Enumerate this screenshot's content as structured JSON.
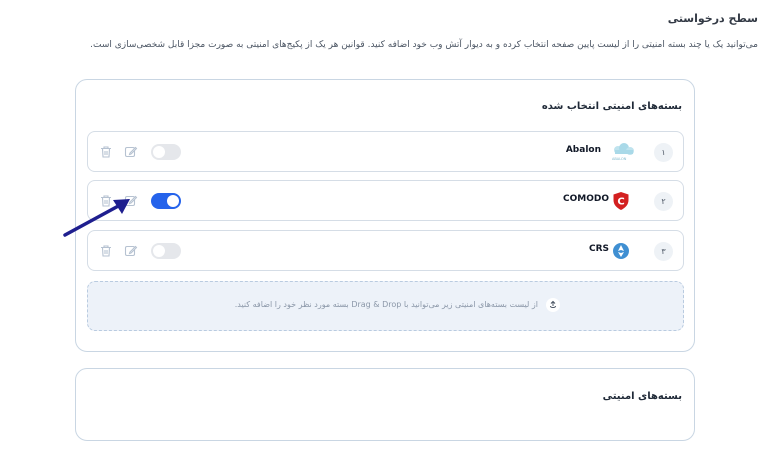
{
  "page": {
    "title": "سطح درخواستی",
    "description": "می‌توانید یک یا چند بسته امنیتی را از لیست پایین صفحه انتخاب کرده و به دیوار آتش وب خود اضافه کنید. قوانین هر یک از پکیج‌های امنیتی به صورت مجزا قابل شخصی‌سازی است."
  },
  "selected_panel": {
    "title": "بسته‌های امنیتی انتخاب شده",
    "rows": [
      {
        "index": "۱",
        "name": "Abalon",
        "logo_caption": "ABALON",
        "enabled": false,
        "logo": "abalon-cloud-logo"
      },
      {
        "index": "۲",
        "name": "COMODO",
        "enabled": true,
        "logo": "comodo-shield-logo"
      },
      {
        "index": "۳",
        "name": "CRS",
        "enabled": false,
        "logo": "crs-circle-logo"
      }
    ],
    "dropzone_text": "از لیست بسته‌های امنیتی زیر می‌توانید با Drag & Drop بسته مورد نظر خود را اضافه کنید."
  },
  "all_panel": {
    "title": "بسته‌های امنیتی"
  },
  "colors": {
    "accent": "#2563eb",
    "border": "#c9d6e3",
    "arrow": "#1f1f8f",
    "icon_muted": "#b6c2d1"
  }
}
